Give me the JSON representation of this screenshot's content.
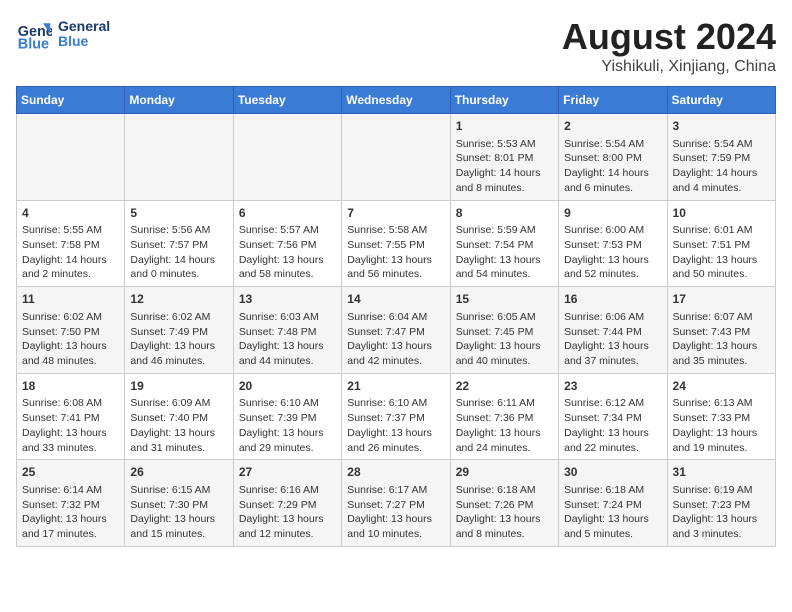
{
  "logo": {
    "text_general": "General",
    "text_blue": "Blue"
  },
  "header": {
    "title": "August 2024",
    "subtitle": "Yishikuli, Xinjiang, China"
  },
  "days_of_week": [
    "Sunday",
    "Monday",
    "Tuesday",
    "Wednesday",
    "Thursday",
    "Friday",
    "Saturday"
  ],
  "weeks": [
    [
      {
        "day": "",
        "content": ""
      },
      {
        "day": "",
        "content": ""
      },
      {
        "day": "",
        "content": ""
      },
      {
        "day": "",
        "content": ""
      },
      {
        "day": "1",
        "content": "Sunrise: 5:53 AM\nSunset: 8:01 PM\nDaylight: 14 hours and 8 minutes."
      },
      {
        "day": "2",
        "content": "Sunrise: 5:54 AM\nSunset: 8:00 PM\nDaylight: 14 hours and 6 minutes."
      },
      {
        "day": "3",
        "content": "Sunrise: 5:54 AM\nSunset: 7:59 PM\nDaylight: 14 hours and 4 minutes."
      }
    ],
    [
      {
        "day": "4",
        "content": "Sunrise: 5:55 AM\nSunset: 7:58 PM\nDaylight: 14 hours and 2 minutes."
      },
      {
        "day": "5",
        "content": "Sunrise: 5:56 AM\nSunset: 7:57 PM\nDaylight: 14 hours and 0 minutes."
      },
      {
        "day": "6",
        "content": "Sunrise: 5:57 AM\nSunset: 7:56 PM\nDaylight: 13 hours and 58 minutes."
      },
      {
        "day": "7",
        "content": "Sunrise: 5:58 AM\nSunset: 7:55 PM\nDaylight: 13 hours and 56 minutes."
      },
      {
        "day": "8",
        "content": "Sunrise: 5:59 AM\nSunset: 7:54 PM\nDaylight: 13 hours and 54 minutes."
      },
      {
        "day": "9",
        "content": "Sunrise: 6:00 AM\nSunset: 7:53 PM\nDaylight: 13 hours and 52 minutes."
      },
      {
        "day": "10",
        "content": "Sunrise: 6:01 AM\nSunset: 7:51 PM\nDaylight: 13 hours and 50 minutes."
      }
    ],
    [
      {
        "day": "11",
        "content": "Sunrise: 6:02 AM\nSunset: 7:50 PM\nDaylight: 13 hours and 48 minutes."
      },
      {
        "day": "12",
        "content": "Sunrise: 6:02 AM\nSunset: 7:49 PM\nDaylight: 13 hours and 46 minutes."
      },
      {
        "day": "13",
        "content": "Sunrise: 6:03 AM\nSunset: 7:48 PM\nDaylight: 13 hours and 44 minutes."
      },
      {
        "day": "14",
        "content": "Sunrise: 6:04 AM\nSunset: 7:47 PM\nDaylight: 13 hours and 42 minutes."
      },
      {
        "day": "15",
        "content": "Sunrise: 6:05 AM\nSunset: 7:45 PM\nDaylight: 13 hours and 40 minutes."
      },
      {
        "day": "16",
        "content": "Sunrise: 6:06 AM\nSunset: 7:44 PM\nDaylight: 13 hours and 37 minutes."
      },
      {
        "day": "17",
        "content": "Sunrise: 6:07 AM\nSunset: 7:43 PM\nDaylight: 13 hours and 35 minutes."
      }
    ],
    [
      {
        "day": "18",
        "content": "Sunrise: 6:08 AM\nSunset: 7:41 PM\nDaylight: 13 hours and 33 minutes."
      },
      {
        "day": "19",
        "content": "Sunrise: 6:09 AM\nSunset: 7:40 PM\nDaylight: 13 hours and 31 minutes."
      },
      {
        "day": "20",
        "content": "Sunrise: 6:10 AM\nSunset: 7:39 PM\nDaylight: 13 hours and 29 minutes."
      },
      {
        "day": "21",
        "content": "Sunrise: 6:10 AM\nSunset: 7:37 PM\nDaylight: 13 hours and 26 minutes."
      },
      {
        "day": "22",
        "content": "Sunrise: 6:11 AM\nSunset: 7:36 PM\nDaylight: 13 hours and 24 minutes."
      },
      {
        "day": "23",
        "content": "Sunrise: 6:12 AM\nSunset: 7:34 PM\nDaylight: 13 hours and 22 minutes."
      },
      {
        "day": "24",
        "content": "Sunrise: 6:13 AM\nSunset: 7:33 PM\nDaylight: 13 hours and 19 minutes."
      }
    ],
    [
      {
        "day": "25",
        "content": "Sunrise: 6:14 AM\nSunset: 7:32 PM\nDaylight: 13 hours and 17 minutes."
      },
      {
        "day": "26",
        "content": "Sunrise: 6:15 AM\nSunset: 7:30 PM\nDaylight: 13 hours and 15 minutes."
      },
      {
        "day": "27",
        "content": "Sunrise: 6:16 AM\nSunset: 7:29 PM\nDaylight: 13 hours and 12 minutes."
      },
      {
        "day": "28",
        "content": "Sunrise: 6:17 AM\nSunset: 7:27 PM\nDaylight: 13 hours and 10 minutes."
      },
      {
        "day": "29",
        "content": "Sunrise: 6:18 AM\nSunset: 7:26 PM\nDaylight: 13 hours and 8 minutes."
      },
      {
        "day": "30",
        "content": "Sunrise: 6:18 AM\nSunset: 7:24 PM\nDaylight: 13 hours and 5 minutes."
      },
      {
        "day": "31",
        "content": "Sunrise: 6:19 AM\nSunset: 7:23 PM\nDaylight: 13 hours and 3 minutes."
      }
    ]
  ]
}
